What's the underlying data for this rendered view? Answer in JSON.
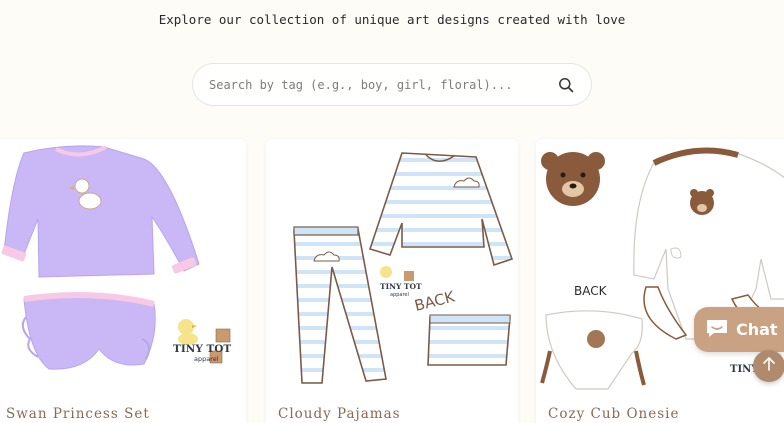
{
  "tagline": "Explore our collection of unique art designs created with love",
  "search": {
    "placeholder": "Search by tag (e.g., boy, girl, floral)...",
    "icon": "search-icon"
  },
  "products": [
    {
      "title": "Swan Princess Set"
    },
    {
      "title": "Cloudy Pajamas"
    },
    {
      "title": "Cozy Cub Onesie"
    }
  ],
  "art_labels": {
    "brand_line1": "TINY TOT",
    "brand_line2": "apparel",
    "back": "BACK"
  },
  "chat": {
    "label": "Chat",
    "icon": "chat-bubble-icon"
  },
  "scroll_top": {
    "icon": "arrow-up-icon"
  },
  "colors": {
    "background": "#fdfcf6",
    "title": "#8a6a52",
    "chat_bg": "#c9a183",
    "lavender": "#c9b8f5",
    "pink": "#f8c9e4",
    "stripe_blue": "#cfe4f7",
    "bear_brown": "#8a5a3c"
  }
}
